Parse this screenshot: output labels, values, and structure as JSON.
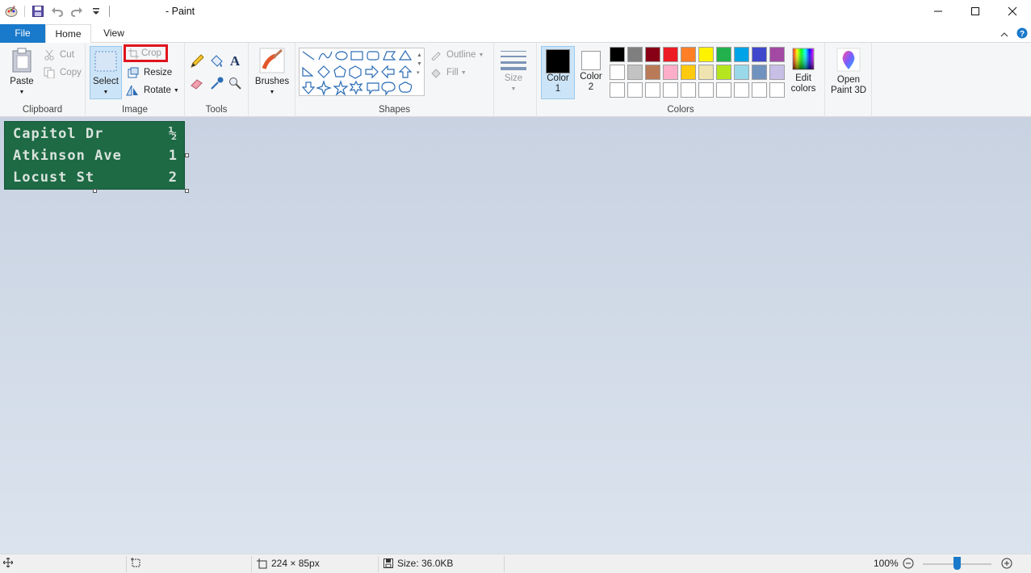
{
  "titlebar": {
    "title": "- Paint"
  },
  "tabs": {
    "file": "File",
    "home": "Home",
    "view": "View"
  },
  "clipboard": {
    "paste": "Paste",
    "cut": "Cut",
    "copy": "Copy",
    "label": "Clipboard"
  },
  "image": {
    "select": "Select",
    "crop": "Crop",
    "resize": "Resize",
    "rotate": "Rotate",
    "label": "Image"
  },
  "tools": {
    "label": "Tools"
  },
  "brushes": {
    "label": "Brushes"
  },
  "shapes": {
    "outline": "Outline",
    "fill": "Fill",
    "label": "Shapes"
  },
  "size": {
    "label": "Size"
  },
  "colors": {
    "color1": "Color",
    "color1_num": "1",
    "color2": "Color",
    "color2_num": "2",
    "edit": "Edit",
    "edit2": "colors",
    "label": "Colors",
    "palette_row1": [
      "#000000",
      "#7f7f7f",
      "#880015",
      "#ed1c24",
      "#ff7f27",
      "#fff200",
      "#22b14c",
      "#00a2e8",
      "#3f48cc",
      "#a349a4"
    ],
    "palette_row2": [
      "#ffffff",
      "#c3c3c3",
      "#b97a57",
      "#ffaec9",
      "#ffc90e",
      "#efe4b0",
      "#b5e61d",
      "#99d9ea",
      "#7092be",
      "#c8bfe7"
    ]
  },
  "paint3d": {
    "line1": "Open",
    "line2": "Paint 3D"
  },
  "canvas_image": {
    "rows": [
      {
        "name": "Capitol Dr",
        "dist": "½"
      },
      {
        "name": "Atkinson Ave",
        "dist": "1"
      },
      {
        "name": "Locust St",
        "dist": "2"
      }
    ]
  },
  "status": {
    "dimensions": "224 × 85px",
    "size": "Size: 36.0KB",
    "zoom": "100%"
  }
}
